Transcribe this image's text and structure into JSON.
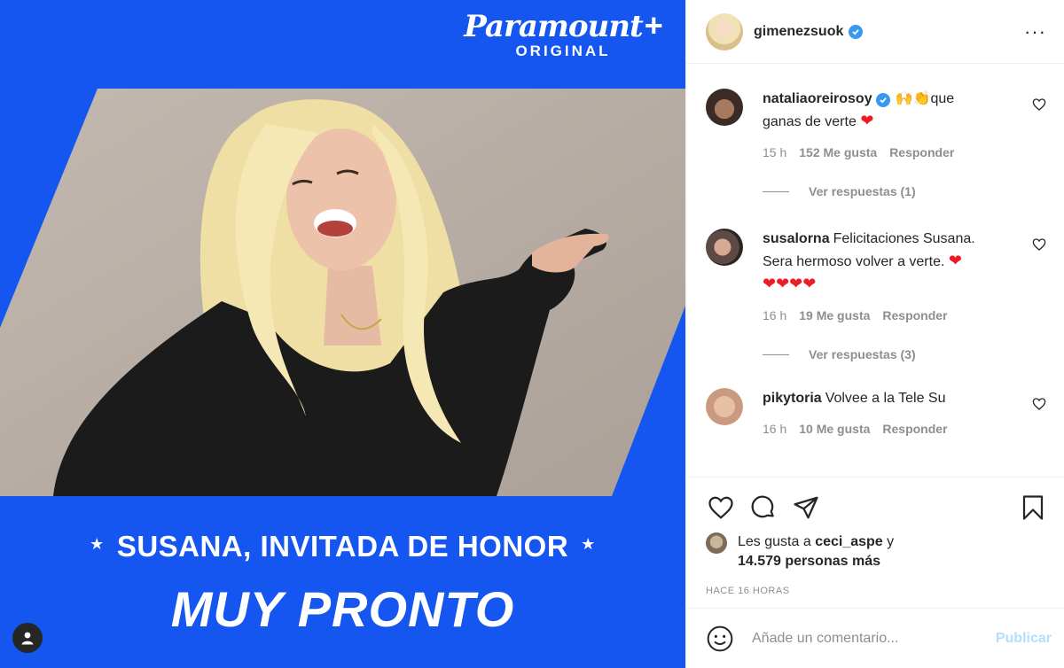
{
  "media": {
    "brand_name": "Paramount",
    "brand_plus": "+",
    "brand_sub": "ORIGINAL",
    "headline": "SUSANA, INVITADA DE HONOR",
    "star": "★",
    "subheadline": "MUY PRONTO",
    "colors": {
      "background": "#1556f0",
      "photo_backdrop": "#b9afa6",
      "hair": "#f1e2a8",
      "outfit": "#1b1b1b"
    }
  },
  "post": {
    "username": "gimenezsuok",
    "more_icon": "···"
  },
  "comments": [
    {
      "username": "nataliaoreirosoy",
      "verified": true,
      "text_line1": "🙌👏que",
      "text_line2": "ganas de verte",
      "heart": "❤",
      "time": "15 h",
      "likes": "152 Me gusta",
      "reply": "Responder",
      "view_replies": "Ver respuestas (1)"
    },
    {
      "username": "susalorna",
      "text_line1": "Felicitaciones Susana.",
      "text_line2": "Sera hermoso volver a verte.",
      "heart": "❤",
      "text_line3": "❤❤❤❤",
      "time": "16 h",
      "likes": "19 Me gusta",
      "reply": "Responder",
      "view_replies": "Ver respuestas (3)"
    },
    {
      "username": "pikytoria",
      "text_line1": "Volvee a la Tele Su",
      "time": "16 h",
      "likes": "10 Me gusta",
      "reply": "Responder"
    }
  ],
  "likes": {
    "prefix": "Les gusta a",
    "user": "ceci_aspe",
    "connector": "y",
    "count": "14.579 personas más"
  },
  "time_ago": "HACE 16 HORAS",
  "add_comment": {
    "placeholder": "Añade un comentario...",
    "publish_label": "Publicar"
  }
}
